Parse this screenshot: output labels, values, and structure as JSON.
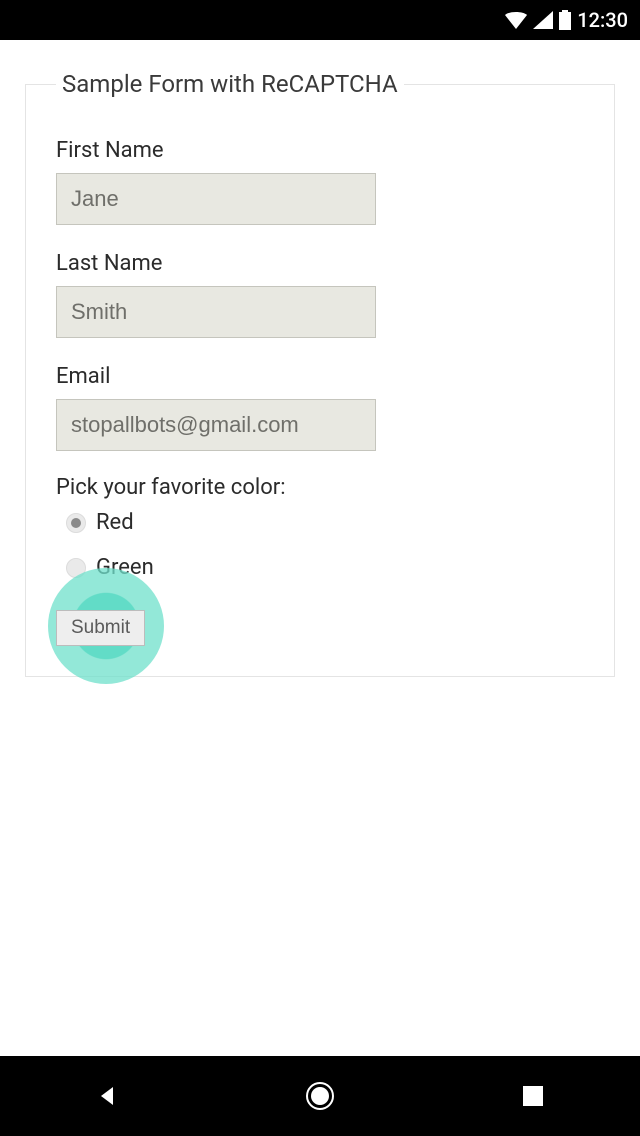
{
  "status": {
    "time": "12:30"
  },
  "form": {
    "title": "Sample Form with ReCAPTCHA",
    "first_name_label": "First Name",
    "first_name_value": "Jane",
    "last_name_label": "Last Name",
    "last_name_value": "Smith",
    "email_label": "Email",
    "email_value": "stopallbots@gmail.com",
    "color_label": "Pick your favorite color:",
    "color_options": {
      "red": "Red",
      "green": "Green"
    },
    "submit_label": "Submit"
  }
}
